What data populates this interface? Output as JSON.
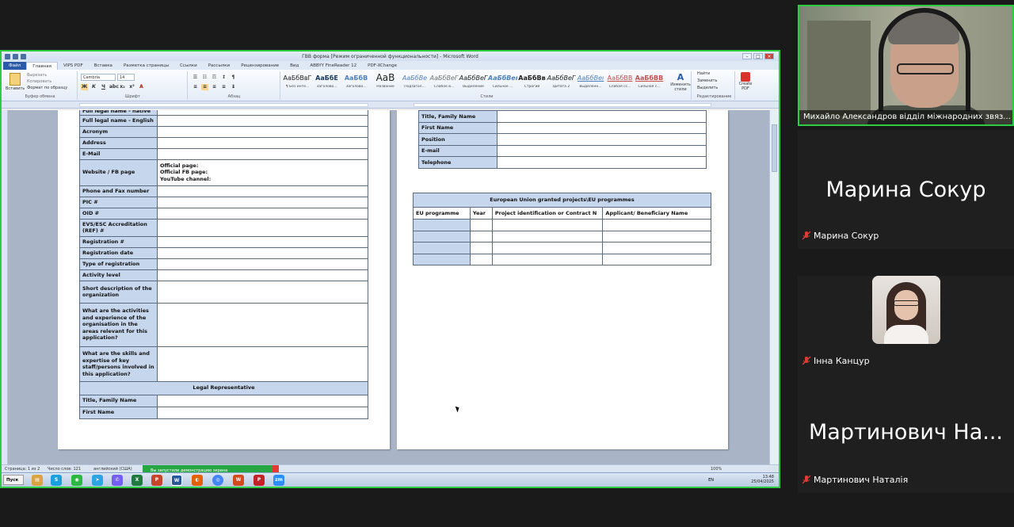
{
  "word": {
    "title": "ГВВ форма [Режим ограниченной функциональности] - Microsoft Word",
    "tabs": [
      "Файл",
      "Главная",
      "VIPS PDF",
      "Вставка",
      "Разметка страницы",
      "Ссылки",
      "Рассылки",
      "Рецензирование",
      "Вид",
      "ABBYY FineReader 12",
      "PDF-XChange"
    ],
    "ribbon": {
      "paste": "Вставить",
      "cut": "Вырезать",
      "copy": "Копировать",
      "format_painter": "Формат по образцу",
      "font_name": "Cambria",
      "font_size": "14",
      "groups": [
        "Буфер обмена",
        "Шрифт",
        "Абзац",
        "Стили",
        "Редактирование"
      ],
      "styles": [
        {
          "sample": "АаБбВвГ",
          "name": "¶ Без инте..."
        },
        {
          "sample": "АаБбЕ",
          "name": "Заголово..."
        },
        {
          "sample": "АаБбВ",
          "name": "Заголово..."
        },
        {
          "sample": "АаВ",
          "name": "Название"
        },
        {
          "sample": "АаБбВе",
          "name": "Подзагол..."
        },
        {
          "sample": "АаБбВеГ",
          "name": "Слабое в..."
        },
        {
          "sample": "АаБбВеГ",
          "name": "Выделение"
        },
        {
          "sample": "АаБбВеı",
          "name": "Сильное ..."
        },
        {
          "sample": "АаБбВв",
          "name": "Строгий"
        },
        {
          "sample": "АаБбВеГ",
          "name": "Цитата 2"
        },
        {
          "sample": "АаБбВеı",
          "name": "Выделенн..."
        },
        {
          "sample": "АаБбВВ",
          "name": "Слабая сс..."
        },
        {
          "sample": "АаБбВВ",
          "name": "Сильная с..."
        }
      ],
      "change_styles": "Изменить стили",
      "find": "Найти",
      "replace": "Заменить",
      "select": "Выделить",
      "create_pdf": "Create PDF"
    },
    "page1": {
      "rows": [
        {
          "label": "Full legal name - native",
          "value": ""
        },
        {
          "label": "Full legal name - English",
          "value": ""
        },
        {
          "label": "Acronym",
          "value": ""
        },
        {
          "label": "Address",
          "value": ""
        },
        {
          "label": "E-Mail",
          "value": ""
        },
        {
          "label": "Website / FB page",
          "value": "Official page:\nOfficial FB page:\nYouTube channel:"
        },
        {
          "label": "Phone and Fax number",
          "value": ""
        },
        {
          "label": "PIC #",
          "value": ""
        },
        {
          "label": "OID #",
          "value": ""
        },
        {
          "label": "EVS/ESC Accreditation (REF) #",
          "value": ""
        },
        {
          "label": "Registration #",
          "value": ""
        },
        {
          "label": "Registration date",
          "value": ""
        },
        {
          "label": "Type of registration",
          "value": ""
        },
        {
          "label": "Activity level",
          "value": ""
        },
        {
          "label": "Short description of the organization",
          "value": ""
        },
        {
          "label": "What are the activities and experience of the organisation in the areas relevant for this application?",
          "value": ""
        },
        {
          "label": "What are the skills and expertise of key staff/persons involved in this application?",
          "value": ""
        }
      ],
      "legal_rep_header": "Legal Representative",
      "legal_rep_rows": [
        {
          "label": "Title, Family Name",
          "value": ""
        },
        {
          "label": "First Name",
          "value": ""
        }
      ]
    },
    "page2": {
      "contact_rows": [
        {
          "label": "Title, Family Name",
          "value": ""
        },
        {
          "label": "First Name",
          "value": ""
        },
        {
          "label": "Position",
          "value": ""
        },
        {
          "label": "E-mail",
          "value": ""
        },
        {
          "label": "Telephone",
          "value": ""
        }
      ],
      "eu_table": {
        "title": "European Union granted projects\\EU programmes",
        "headers": [
          "EU programme",
          "Year",
          "Project identification or Contract N",
          "Applicant/ Beneficiary Name"
        ],
        "empty_rows": 4
      }
    },
    "status": {
      "page": "Страница: 1 из 2",
      "words": "Число слов: 121",
      "language": "английский (США)",
      "zoom": "100%"
    },
    "share_banner": "Вы запустили демонстрацию экрана",
    "taskbar": {
      "start": "Пуск",
      "lang": "EN",
      "time": "13:48",
      "date": "25/04/2025"
    }
  },
  "participants": [
    {
      "display": "Михайло Александров відділ міжнародних звяз...",
      "video": true
    },
    {
      "display": "Марина Сокур",
      "big": "Марина Сокур",
      "muted": true
    },
    {
      "display": "Інна Канцур",
      "muted": true,
      "avatar": true
    },
    {
      "display": "Мартинович Наталія",
      "big": "Мартинович На...",
      "muted": true
    }
  ]
}
